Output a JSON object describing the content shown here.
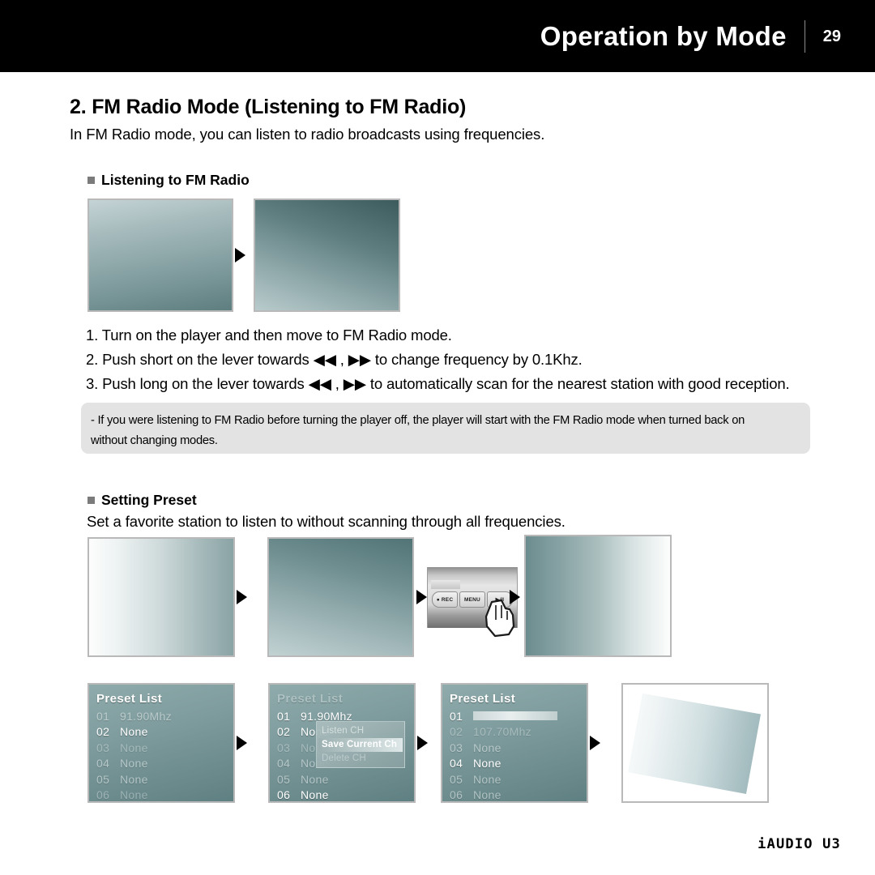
{
  "header": {
    "title": "Operation by Mode",
    "page_number": "29"
  },
  "section": {
    "heading": "2. FM Radio Mode (Listening to FM Radio)",
    "intro": "In FM Radio mode, you can listen to radio broadcasts using frequencies."
  },
  "listening": {
    "sub_heading": "Listening to FM Radio",
    "steps": [
      "1. Turn on the player and then move to FM Radio mode.",
      "2. Push short on the lever towards ◀◀ , ▶▶ to change frequency by 0.1Khz.",
      "3. Push long on the lever towards ◀◀ , ▶▶ to automatically scan for the nearest station with good reception."
    ]
  },
  "note": {
    "line1": "- If you were listening to FM Radio before turning the player off, the player will start with the FM Radio mode when turned back on",
    "line2": "without changing modes."
  },
  "preset": {
    "sub_heading": "Setting Preset",
    "intro": "Set a favorite station to listen to without scanning through all frequencies."
  },
  "device": {
    "buttons": [
      "● REC",
      "MENU",
      "▶/‖"
    ]
  },
  "preset_screens": [
    {
      "title": "Preset List",
      "rows": [
        {
          "index": "01",
          "value": "91.90Mhz"
        },
        {
          "index": "02",
          "value": "None"
        },
        {
          "index": "03",
          "value": "None"
        },
        {
          "index": "04",
          "value": "None"
        },
        {
          "index": "05",
          "value": "None"
        },
        {
          "index": "06",
          "value": "None"
        }
      ]
    },
    {
      "title": "Preset List",
      "rows": [
        {
          "index": "01",
          "value": "91.90Mhz"
        },
        {
          "index": "02",
          "value": "None"
        },
        {
          "index": "03",
          "value": "None"
        },
        {
          "index": "04",
          "value": "None"
        },
        {
          "index": "05",
          "value": "None"
        },
        {
          "index": "06",
          "value": "None"
        }
      ],
      "popup": {
        "items": [
          "Listen CH",
          "Save Current Ch",
          "Delete CH"
        ],
        "selected": "Save Current Ch"
      }
    },
    {
      "title": "Preset List",
      "rows": [
        {
          "index": "01",
          "value": ""
        },
        {
          "index": "02",
          "value": "107.70Mhz"
        },
        {
          "index": "03",
          "value": "None"
        },
        {
          "index": "04",
          "value": "None"
        },
        {
          "index": "05",
          "value": "None"
        },
        {
          "index": "06",
          "value": "None"
        }
      ]
    }
  ],
  "footer": {
    "logo": "iAUDIO U3"
  },
  "colors": {
    "header_bg": "#000000",
    "note_bg": "#e3e3e3",
    "bullet": "#7b7b7b",
    "screen_border": "#b9b9b9"
  }
}
